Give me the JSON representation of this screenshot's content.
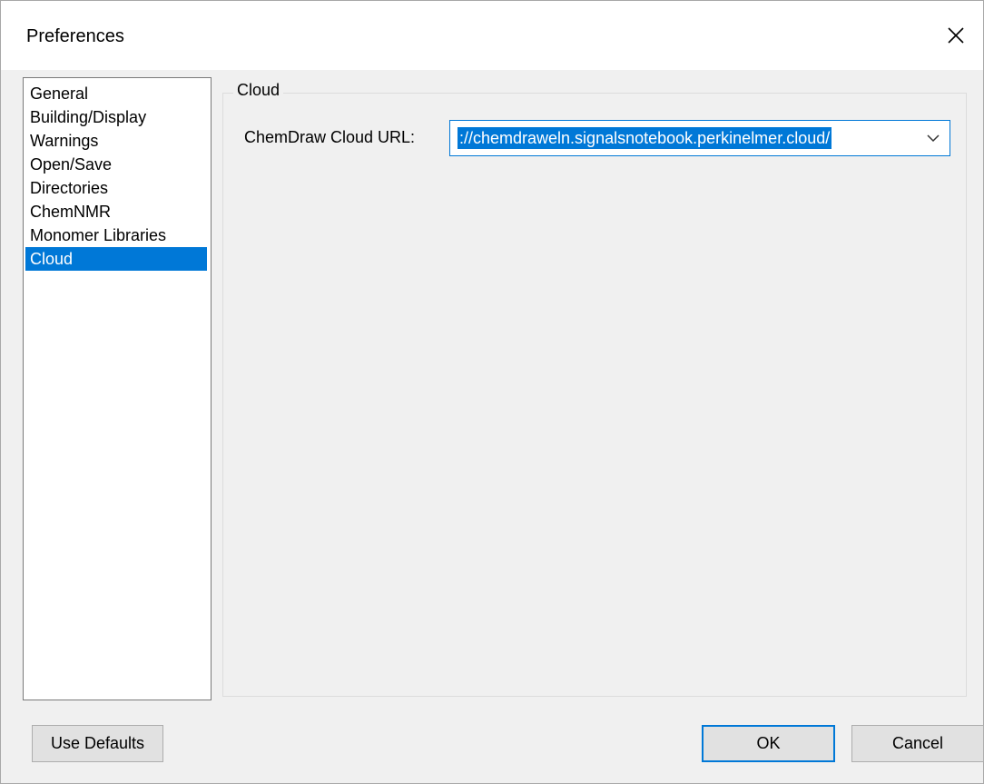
{
  "window": {
    "title": "Preferences"
  },
  "sidebar": {
    "items": [
      {
        "label": "General",
        "selected": false
      },
      {
        "label": "Building/Display",
        "selected": false
      },
      {
        "label": "Warnings",
        "selected": false
      },
      {
        "label": "Open/Save",
        "selected": false
      },
      {
        "label": "Directories",
        "selected": false
      },
      {
        "label": "ChemNMR",
        "selected": false
      },
      {
        "label": "Monomer Libraries",
        "selected": false
      },
      {
        "label": "Cloud",
        "selected": true
      }
    ]
  },
  "cloud": {
    "group_title": "Cloud",
    "url_label": "ChemDraw Cloud URL:",
    "url_value": "://chemdraweln.signalsnotebook.perkinelmer.cloud/"
  },
  "footer": {
    "use_defaults_label": "Use Defaults",
    "ok_label": "OK",
    "cancel_label": "Cancel"
  },
  "colors": {
    "accent": "#0078d7",
    "dialog_background": "#f0f0f0",
    "button_face": "#e1e1e1"
  },
  "icons": {
    "close": "close-icon",
    "dropdown": "chevron-down-icon"
  }
}
